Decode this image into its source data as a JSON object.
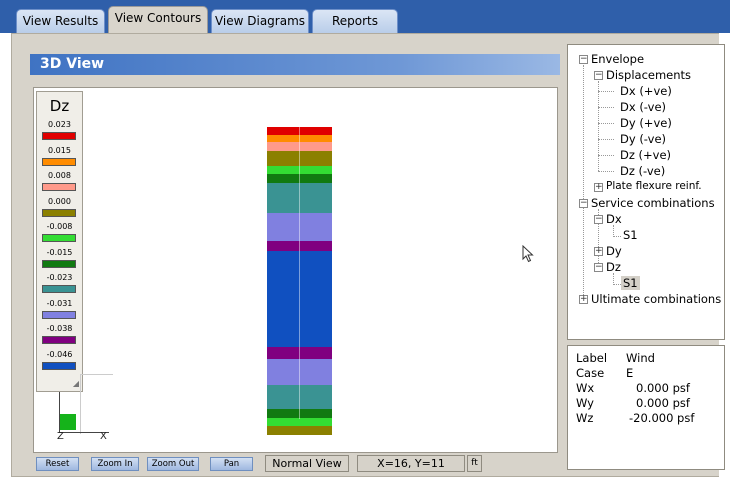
{
  "tabs": [
    {
      "label": "View Results",
      "active": false
    },
    {
      "label": "View Contours",
      "active": true
    },
    {
      "label": "View Diagrams",
      "active": false
    },
    {
      "label": "Reports",
      "active": false
    }
  ],
  "view": {
    "title": "3D View"
  },
  "legend": {
    "title": "Dz",
    "entries": [
      {
        "value": "0.023",
        "color": "#e00000"
      },
      {
        "value": "0.015",
        "color": "#ff8c00"
      },
      {
        "value": "0.008",
        "color": "#ff9a8a"
      },
      {
        "value": "0.000",
        "color": "#8b8000"
      },
      {
        "value": "-0.008",
        "color": "#33dd33"
      },
      {
        "value": "-0.015",
        "color": "#117a11"
      },
      {
        "value": "-0.023",
        "color": "#3a9393"
      },
      {
        "value": "-0.031",
        "color": "#8080e0"
      },
      {
        "value": "-0.038",
        "color": "#800080"
      },
      {
        "value": "-0.046",
        "color": "#1050c0"
      }
    ]
  },
  "axes": {
    "z": "Z",
    "x": "X"
  },
  "tree": {
    "envelope": "Envelope",
    "displacements": "Displacements",
    "disp_items": [
      "Dx (+ve)",
      "Dx (-ve)",
      "Dy (+ve)",
      "Dy (-ve)",
      "Dz (+ve)",
      "Dz (-ve)"
    ],
    "plate_flexure": "Plate flexure reinf.",
    "service": "Service combinations",
    "dx": "Dx",
    "dx_s1": "S1",
    "dy": "Dy",
    "dz": "Dz",
    "dz_s1": "S1",
    "ultimate": "Ultimate combinations"
  },
  "properties": {
    "rows": [
      {
        "label": "Label",
        "value": "Wind"
      },
      {
        "label": "Case",
        "value": "E"
      },
      {
        "label": "Wx",
        "value": "0.000 psf"
      },
      {
        "label": "Wy",
        "value": "0.000 psf"
      },
      {
        "label": "Wz",
        "value": "-20.000 psf"
      }
    ]
  },
  "toolbar": {
    "reset": "Reset",
    "zoom_in": "Zoom In",
    "zoom_out": "Zoom Out",
    "pan": "Pan",
    "view_mode": "Normal View",
    "coords": "X=16, Y=11",
    "unit": "ft"
  }
}
